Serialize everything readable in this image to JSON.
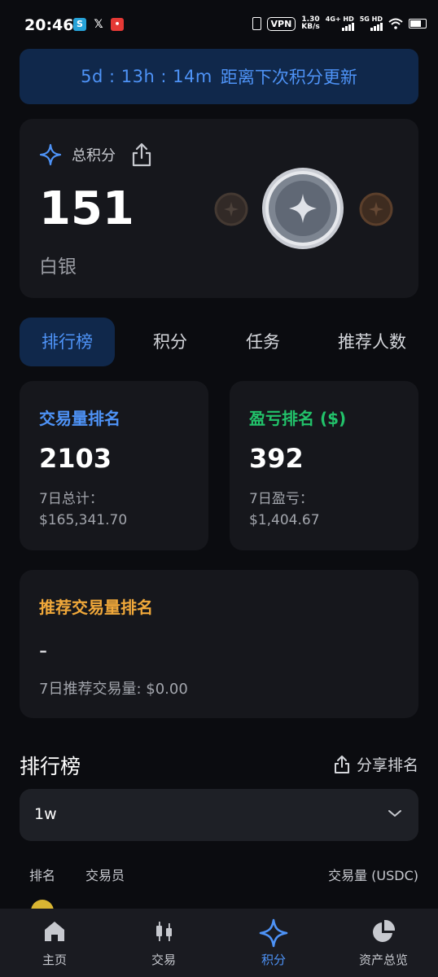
{
  "status_bar": {
    "time": "20:46",
    "vpn": "VPN",
    "speed_value": "1.30",
    "speed_unit": "KB/s",
    "net1": "4G+ HD",
    "net2": "5G HD"
  },
  "banner": {
    "countdown": "5d : 13h : 14m",
    "text": "距离下次积分更新"
  },
  "points_card": {
    "label": "总积分",
    "value": "151",
    "tier": "白银"
  },
  "tabs": [
    {
      "label": "排行榜",
      "active": true
    },
    {
      "label": "积分"
    },
    {
      "label": "任务"
    },
    {
      "label": "推荐人数"
    }
  ],
  "volume_rank": {
    "title": "交易量排名",
    "value": "2103",
    "sub_label": "7日总计：",
    "sub_value": "$165,341.70",
    "color": "#4e93f7"
  },
  "pnl_rank": {
    "title": "盈亏排名 ($)",
    "value": "392",
    "sub_label": "7日盈亏：",
    "sub_value": "$1,404.67",
    "color": "#22c26a"
  },
  "referral_rank": {
    "title": "推荐交易量排名",
    "value": "-",
    "sub": "7日推荐交易量: $0.00",
    "color": "#f0a83a"
  },
  "leaderboard": {
    "title": "排行榜",
    "share_label": "分享排名",
    "period": "1w",
    "columns": {
      "rank": "排名",
      "trader": "交易员",
      "volume": "交易量 (USDC)"
    }
  },
  "bottom_nav": [
    {
      "label": "主页",
      "icon": "home-icon"
    },
    {
      "label": "交易",
      "icon": "candlestick-icon"
    },
    {
      "label": "积分",
      "icon": "sparkle-icon",
      "active": true
    },
    {
      "label": "资产总览",
      "icon": "pie-chart-icon"
    }
  ],
  "colors": {
    "accent": "#4e93f7",
    "background": "#0b0c10",
    "card": "#16171c"
  }
}
